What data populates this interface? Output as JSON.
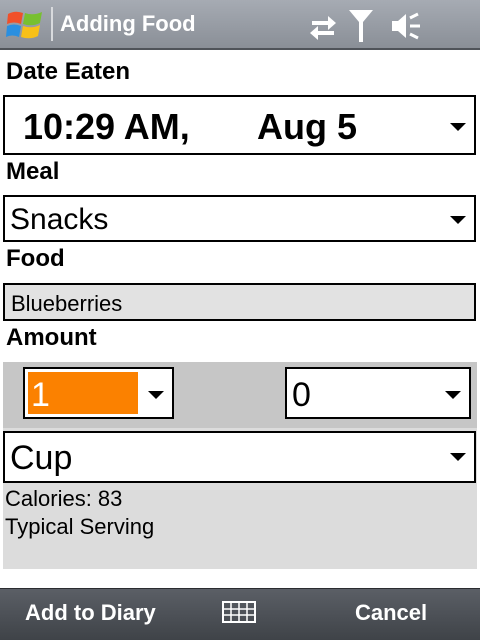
{
  "window": {
    "title": "Adding Food",
    "status_icons": [
      "windows-start-icon",
      "sync-icon",
      "signal-antenna-icon",
      "volume-icon"
    ]
  },
  "form": {
    "date_label": "Date Eaten",
    "date_time": "10:29 AM,",
    "date_day": "Aug  5",
    "meal_label": "Meal",
    "meal_value": "Snacks",
    "food_label": "Food",
    "food_value": "Blueberries",
    "amount_label": "Amount",
    "amount_whole": "1",
    "amount_fraction": "0",
    "unit_value": "Cup",
    "calories": "Calories: 83",
    "serving_note": "Typical Serving"
  },
  "softkeys": {
    "left": "Add to Diary",
    "right": "Cancel",
    "center_icon": "keyboard-icon"
  },
  "colors": {
    "selection": "#fb8100",
    "titlebar": "#8a8f97",
    "softbar": "#4a4e54"
  }
}
